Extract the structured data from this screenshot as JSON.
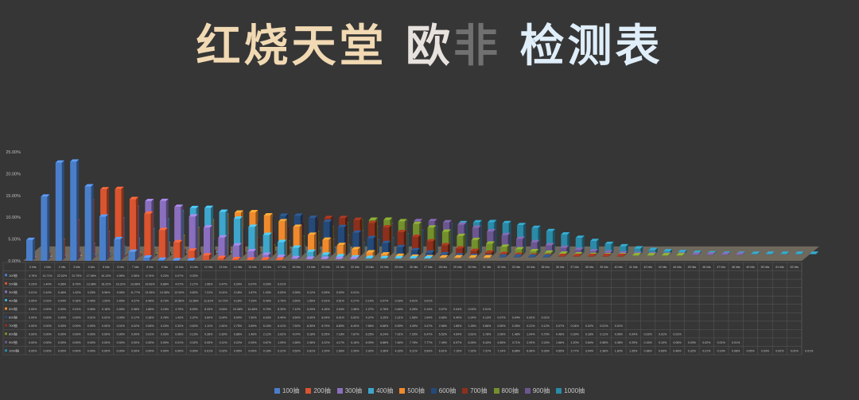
{
  "title": {
    "part1": "红烧天堂",
    "part2": "欧",
    "part3": "非",
    "part4": "检测表"
  },
  "chart_data": {
    "type": "bar",
    "title": "红烧天堂 欧非 检测表",
    "y_ticks": [
      "0.00%",
      "5.00%",
      "10.00%",
      "15.00%",
      "20.00%",
      "25.00%"
    ],
    "ylim": [
      0,
      25
    ],
    "categories": [
      "0 hits",
      "1 hits",
      "2 hits",
      "3 hits",
      "4 hits",
      "5 hits",
      "6 hits",
      "7 hits",
      "8 hits",
      "9 hits",
      "10 hits",
      "11 hits",
      "12 hits",
      "13 hits",
      "14 hits",
      "15 hits",
      "16 hits",
      "17 hits",
      "18 hits",
      "19 hits",
      "20 hits",
      "21 hits",
      "22 hits",
      "23 hits",
      "24 hits",
      "25 hits",
      "26 hits",
      "27 hits",
      "28 hits",
      "29 hits",
      "30 hits",
      "31 hits",
      "32 hits",
      "33 hits",
      "34 hits",
      "35 hits",
      "36 hits",
      "37 hits",
      "38 hits",
      "39 hits",
      "40 hits",
      "41 hits",
      "42 hits",
      "43 hits",
      "44 hits",
      "45 hits",
      "46 hits",
      "47 hits",
      "48 hits",
      "49 hits",
      "50 hits",
      "51 hits",
      "52 hits"
    ],
    "series": [
      {
        "name": "100抽",
        "color": "#4a7ec9",
        "values": [
          "4.76%",
          "14.71%",
          "22.52%",
          "22.75%",
          "17.06%",
          "10.13%",
          "4.96%",
          "2.06%",
          "0.74%",
          "0.23%",
          "0.07%",
          "0.02%"
        ]
      },
      {
        "name": "200抽",
        "color": "#d9542f",
        "values": [
          "0.23%",
          "1.40%",
          "4.38%",
          "8.79%",
          "13.38%",
          "16.22%",
          "16.31%",
          "13.98%",
          "10.63%",
          "6.88%",
          "4.07%",
          "2.17%",
          "1.06%",
          "0.47%",
          "0.20%",
          "0.07%",
          "0.03%",
          "0.01%"
        ]
      },
      {
        "name": "300抽",
        "color": "#8a6fbf",
        "values": [
          "0.01%",
          "0.10%",
          "0.46%",
          "1.42%",
          "3.25%",
          "5.96%",
          "9.06%",
          "11.77%",
          "13.35%",
          "13.38%",
          "12.04%",
          "9.82%",
          "7.31%",
          "5.01%",
          "3.18%",
          "1.87%",
          "1.03%",
          "0.53%",
          "0.26%",
          "0.12%",
          "0.05%",
          "0.02%",
          "0.01%"
        ]
      },
      {
        "name": "400抽",
        "color": "#3ea6cc",
        "values": [
          "0.00%",
          "0.01%",
          "0.04%",
          "0.16%",
          "0.49%",
          "1.20%",
          "2.45%",
          "4.27%",
          "6.48%",
          "8.73%",
          "10.56%",
          "11.58%",
          "11.61%",
          "10.72%",
          "9.16%",
          "7.29%",
          "5.43%",
          "3.79%",
          "2.50%",
          "1.55%",
          "0.91%",
          "0.51%",
          "0.27%",
          "0.14%",
          "0.07%",
          "0.03%",
          "0.01%",
          "0.01%"
        ]
      },
      {
        "name": "500抽",
        "color": "#f08a2c",
        "values": [
          "0.00%",
          "0.00%",
          "0.00%",
          "0.01%",
          "0.06%",
          "0.18%",
          "0.45%",
          "0.98%",
          "1.86%",
          "3.15%",
          "4.79%",
          "6.59%",
          "8.33%",
          "9.63%",
          "10.38%",
          "10.48%",
          "9.75%",
          "8.39%",
          "7.12%",
          "5.29%",
          "4.16%",
          "2.94%",
          "1.98%",
          "1.27%",
          "0.78%",
          "0.46%",
          "0.26%",
          "0.14%",
          "0.07%",
          "0.04%",
          "0.02%",
          "0.01%"
        ]
      },
      {
        "name": "600抽",
        "color": "#244a7a",
        "values": [
          "0.00%",
          "0.00%",
          "0.00%",
          "0.00%",
          "0.01%",
          "0.02%",
          "0.06%",
          "0.17%",
          "0.38%",
          "0.76%",
          "1.43%",
          "2.37%",
          "3.60%",
          "5.04%",
          "6.54%",
          "7.90%",
          "8.93%",
          "9.49%",
          "9.50%",
          "9.00%",
          "8.09%",
          "6.91%",
          "5.62%",
          "4.37%",
          "3.25%",
          "2.31%",
          "1.58%",
          "1.04%",
          "0.66%",
          "0.40%",
          "0.24%",
          "0.13%",
          "0.07%",
          "0.04%",
          "0.02%",
          "0.01%"
        ]
      },
      {
        "name": "700抽",
        "color": "#8c2f1c",
        "values": [
          "0.00%",
          "0.00%",
          "0.00%",
          "0.00%",
          "0.00%",
          "0.00%",
          "0.01%",
          "0.02%",
          "0.06%",
          "0.15%",
          "0.32%",
          "0.62%",
          "1.11%",
          "1.81%",
          "2.75%",
          "3.89%",
          "5.15%",
          "6.41%",
          "7.52%",
          "8.35%",
          "8.79%",
          "8.80%",
          "8.40%",
          "7.66%",
          "6.68%",
          "5.59%",
          "4.49%",
          "3.47%",
          "2.58%",
          "1.85%",
          "1.28%",
          "0.86%",
          "0.55%",
          "0.35%",
          "0.21%",
          "0.12%",
          "0.07%",
          "0.04%",
          "0.02%",
          "0.01%",
          "0.01%"
        ]
      },
      {
        "name": "800抽",
        "color": "#74902c",
        "values": [
          "0.00%",
          "0.00%",
          "0.00%",
          "0.00%",
          "0.00%",
          "0.00%",
          "0.00%",
          "0.00%",
          "0.01%",
          "0.03%",
          "0.06%",
          "0.13%",
          "0.26%",
          "0.30%",
          "0.86%",
          "1.46%",
          "2.12%",
          "3.02%",
          "4.07%",
          "5.18%",
          "6.25%",
          "7.18%",
          "7.87%",
          "8.25%",
          "8.24%",
          "7.91%",
          "7.29%",
          "6.47%",
          "5.52%",
          "4.54%",
          "3.61%",
          "2.78%",
          "2.06%",
          "1.48%",
          "1.04%",
          "0.70%",
          "0.46%",
          "0.29%",
          "0.18%",
          "0.11%",
          "0.06%",
          "0.04%",
          "0.02%",
          "0.01%",
          "0.01%"
        ]
      },
      {
        "name": "900抽",
        "color": "#6b5690",
        "values": [
          "0.00%",
          "0.00%",
          "0.00%",
          "0.00%",
          "0.00%",
          "0.00%",
          "0.00%",
          "0.00%",
          "0.00%",
          "0.00%",
          "0.01%",
          "0.02%",
          "0.05%",
          "0.11%",
          "0.22%",
          "0.39%",
          "0.67%",
          "1.09%",
          "1.65%",
          "2.36%",
          "3.22%",
          "4.17%",
          "5.16%",
          "6.09%",
          "6.88%",
          "7.46%",
          "7.76%",
          "7.77%",
          "7.49%",
          "6.97%",
          "6.26%",
          "5.43%",
          "4.56%",
          "3.71%",
          "2.93%",
          "2.24%",
          "1.66%",
          "1.20%",
          "0.84%",
          "0.58%",
          "0.38%",
          "0.25%",
          "0.16%",
          "0.10%",
          "0.06%",
          "0.03%",
          "0.02%",
          "0.01%",
          "0.01%"
        ]
      },
      {
        "name": "1000抽",
        "color": "#2a8aa8",
        "values": [
          "0.00%",
          "0.00%",
          "0.00%",
          "0.00%",
          "0.00%",
          "0.00%",
          "0.00%",
          "0.00%",
          "0.00%",
          "0.00%",
          "0.00%",
          "0.00%",
          "0.01%",
          "0.02%",
          "0.05%",
          "0.09%",
          "0.18%",
          "0.31%",
          "0.52%",
          "0.81%",
          "1.20%",
          "1.69%",
          "2.26%",
          "2.92%",
          "3.36%",
          "4.33%",
          "5.11%",
          "5.93%",
          "6.61%",
          "7.15%",
          "7.32%",
          "7.37%",
          "7.14%",
          "6.68%",
          "6.06%",
          "5.33%",
          "4.55%",
          "3.77%",
          "3.04%",
          "2.38%",
          "1.82%",
          "1.35%",
          "0.98%",
          "0.69%",
          "0.48%",
          "0.32%",
          "0.21%",
          "0.14%",
          "0.08%",
          "0.05%",
          "0.03%",
          "0.02%",
          "0.01%",
          "0.01%"
        ]
      }
    ],
    "legend_position": "bottom",
    "grid": true
  }
}
